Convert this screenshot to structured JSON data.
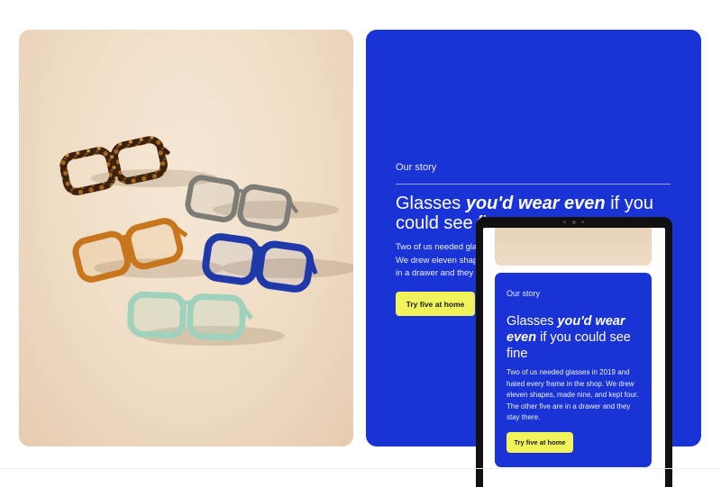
{
  "story": {
    "eyebrow": "Our story",
    "title_pre": "Glasses ",
    "title_em": "you'd wear even",
    "title_post": " if you could see fine",
    "body": "Two of us needed glasses in 2019 and hated every frame in the shop. We drew eleven shapes, made nine, and kept four. The other five are in a drawer and they stay there.",
    "cta_label": "Try five at home"
  },
  "tablet": {
    "eyebrow": "Our story",
    "title_pre": "Glasses ",
    "title_em1": "you'd wear",
    "title_em2": "even",
    "title_post": " if you could see fine",
    "body": "Two of us needed glasses in 2019 and hated every frame in the shop. We drew eleven shapes, made nine, and kept four. The other five are in a drawer and they stay there.",
    "cta_label": "Try five at home"
  },
  "colors": {
    "brand_blue": "#1a33d6",
    "cta_yellow": "#f0f45a",
    "photo_bg": "#efdcc4"
  },
  "photo": {
    "frames": [
      {
        "name": "tortoise",
        "color": "#5a3518"
      },
      {
        "name": "grey",
        "color": "#7d7c76"
      },
      {
        "name": "amber",
        "color": "#c7761d"
      },
      {
        "name": "navy",
        "color": "#1f3aa8"
      },
      {
        "name": "mint",
        "color": "#9fd1bd"
      }
    ]
  }
}
